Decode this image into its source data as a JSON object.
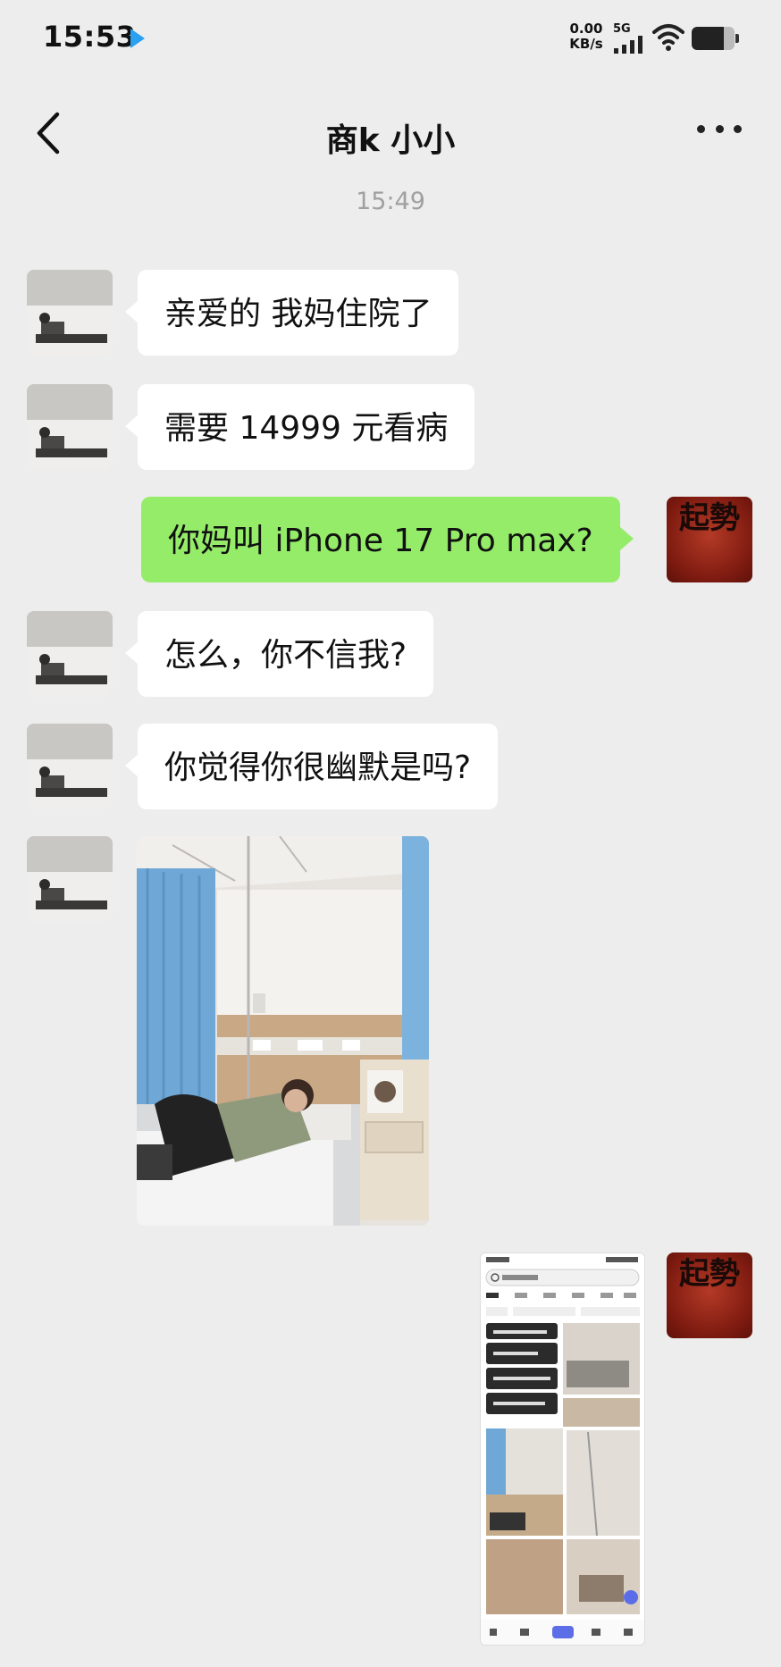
{
  "status_bar": {
    "time": "15:53",
    "net_speed_value": "0.00",
    "net_speed_unit": "KB/s",
    "signal_label": "5G",
    "battery_level": 0.75
  },
  "header": {
    "title": "商k 小小",
    "back_icon": "chevron-left-icon",
    "more_icon": "more-dots-icon"
  },
  "timestamp": "15:49",
  "messages": [
    {
      "side": "left",
      "type": "text",
      "text": "亲爱的 我妈住院了"
    },
    {
      "side": "left",
      "type": "text",
      "text": "需要 14999 元看病"
    },
    {
      "side": "right",
      "type": "text",
      "text": "你妈叫 iPhone 17 Pro max?"
    },
    {
      "side": "left",
      "type": "text",
      "text": "怎么，你不信我?"
    },
    {
      "side": "left",
      "type": "text",
      "text": "你觉得你很幽默是吗?"
    },
    {
      "side": "left",
      "type": "image",
      "description_icon": "hospital-photo"
    },
    {
      "side": "right",
      "type": "image",
      "description_icon": "search-results-screenshot"
    }
  ],
  "self_avatar_text": "起勢",
  "colors": {
    "background": "#ededed",
    "bubble_left": "#ffffff",
    "bubble_right": "#95ec69",
    "timestamp": "#a0a0a0",
    "avatar_red": "#8e1f12"
  }
}
